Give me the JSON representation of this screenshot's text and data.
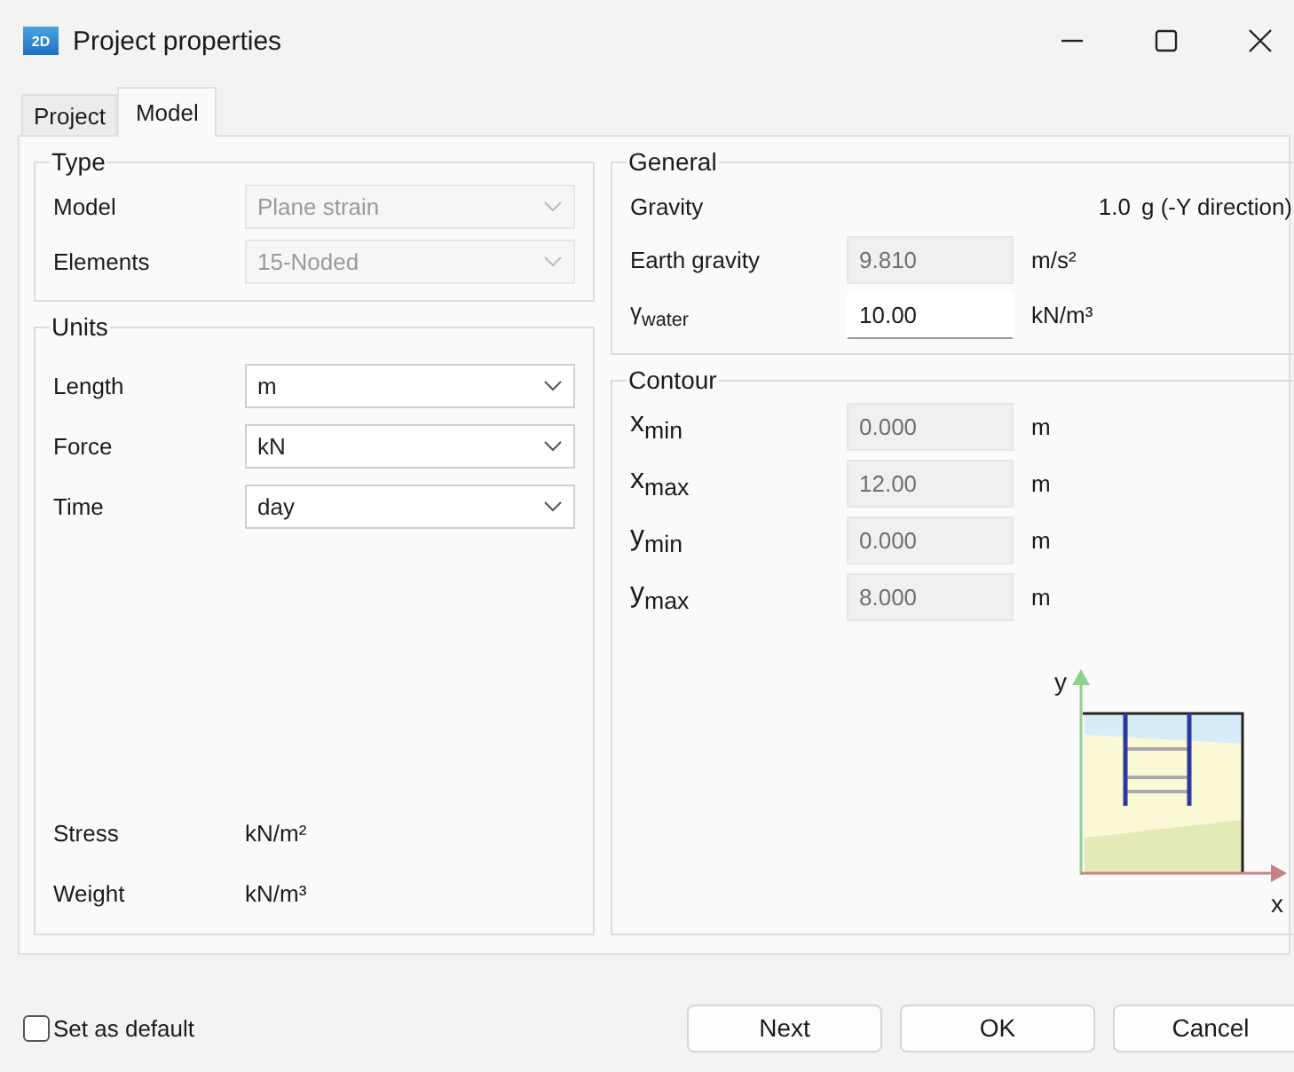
{
  "window": {
    "title": "Project properties",
    "app_badge": "2D"
  },
  "tabs": [
    {
      "label": "Project",
      "selected": false
    },
    {
      "label": "Model",
      "selected": true
    }
  ],
  "type_group": {
    "title": "Type",
    "rows": [
      {
        "label": "Model",
        "value": "Plane strain",
        "disabled": true
      },
      {
        "label": "Elements",
        "value": "15-Noded",
        "disabled": true
      }
    ]
  },
  "units_group": {
    "title": "Units",
    "selects": [
      {
        "label": "Length",
        "value": "m",
        "disabled": false
      },
      {
        "label": "Force",
        "value": "kN",
        "disabled": false
      },
      {
        "label": "Time",
        "value": "day",
        "disabled": false
      }
    ],
    "derived": [
      {
        "label": "Stress",
        "value": "kN/m²"
      },
      {
        "label": "Weight",
        "value": "kN/m³"
      }
    ]
  },
  "general": {
    "title": "General",
    "gravity": {
      "label": "Gravity",
      "value": "1.0",
      "unit": "g (-Y direction)"
    },
    "fields": [
      {
        "label": "Earth gravity",
        "value": "9.810",
        "unit": "m/s²",
        "disabled": true
      },
      {
        "label": "γ$_{water}$",
        "value": "10.00",
        "unit": "kN/m³",
        "disabled": false
      }
    ]
  },
  "contour": {
    "title": "Contour",
    "fields": [
      {
        "label": "x$_{min}$",
        "value": "0.000",
        "unit": "m",
        "disabled": true
      },
      {
        "label": "x$_{max}$",
        "value": "12.00",
        "unit": "m",
        "disabled": true
      },
      {
        "label": "y$_{min}$",
        "value": "0.000",
        "unit": "m",
        "disabled": true
      },
      {
        "label": "y$_{max}$",
        "value": "8.000",
        "unit": "m",
        "disabled": true
      }
    ],
    "axis_labels": {
      "y": "y",
      "x": "x"
    }
  },
  "footer": {
    "checkbox": {
      "label": "Set as default",
      "checked": false
    },
    "buttons": [
      "Next",
      "OK",
      "Cancel"
    ]
  }
}
